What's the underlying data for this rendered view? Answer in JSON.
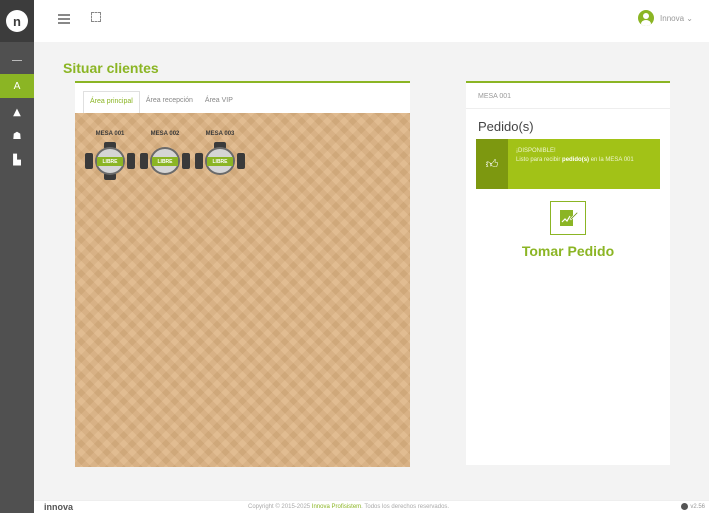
{
  "app": {
    "logo_letter": "n",
    "colors": {
      "accent": "#8bb524",
      "sidebar": "#505050",
      "floor": "#ddb382"
    }
  },
  "sidebar": {
    "items": [
      {
        "icon": "waiter-icon",
        "glyph": "A",
        "active": true
      },
      {
        "icon": "cloche-icon",
        "glyph": "▲",
        "active": false
      },
      {
        "icon": "group-icon",
        "glyph": "☗",
        "active": false
      },
      {
        "icon": "building-icon",
        "glyph": "▙",
        "active": false
      }
    ]
  },
  "topbar": {
    "user_name": "Innova ⌄"
  },
  "page": {
    "title": "Situar clientes"
  },
  "areas": {
    "tabs": [
      {
        "label": "Área principal",
        "active": true
      },
      {
        "label": "Área recepción",
        "active": false
      },
      {
        "label": "Área VIP",
        "active": false
      }
    ],
    "tables": [
      {
        "name": "MESA 001",
        "status": "LIBRE"
      },
      {
        "name": "MESA 002",
        "status": "LIBRE"
      },
      {
        "name": "MESA 003",
        "status": "LIBRE"
      }
    ]
  },
  "detail": {
    "header": "MESA 001",
    "title": "Pedido(s)",
    "alert": {
      "heading": "¡DISPONIBLE!",
      "text_before": "Listo para recibir ",
      "text_bold": "pedido(s)",
      "text_after": " en la MESA 001"
    },
    "take_order_label": "Tomar Pedido"
  },
  "footer": {
    "brand": "innova",
    "copyright": "Copyright © 2015-2025 ",
    "company": "Innova Profisistem",
    "rights": ". Todos los derechos reservados.",
    "version": "v2.56"
  }
}
